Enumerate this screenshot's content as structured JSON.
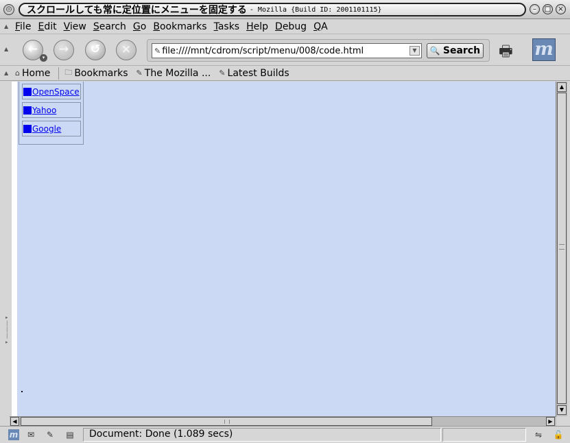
{
  "window": {
    "title": "スクロールしても常に定位置にメニューを固定する",
    "subtitle": "- Mozilla {Build ID: 2001101115}"
  },
  "menubar": {
    "items": [
      {
        "hotkey": "F",
        "rest": "ile"
      },
      {
        "hotkey": "E",
        "rest": "dit"
      },
      {
        "hotkey": "V",
        "rest": "iew"
      },
      {
        "hotkey": "S",
        "rest": "earch"
      },
      {
        "hotkey": "G",
        "rest": "o"
      },
      {
        "hotkey": "B",
        "rest": "ookmarks"
      },
      {
        "hotkey": "T",
        "rest": "asks"
      },
      {
        "hotkey": "H",
        "rest": "elp"
      },
      {
        "hotkey": "D",
        "rest": "ebug"
      },
      {
        "hotkey": "Q",
        "rest": "A"
      }
    ]
  },
  "navbar": {
    "url": "file:////mnt/cdrom/script/menu/008/code.html",
    "search_label": "Search",
    "throbber_letter": "m"
  },
  "personal_toolbar": {
    "home": "Home",
    "bookmarks": "Bookmarks",
    "mozilla": "The Mozilla ...",
    "latest": "Latest Builds"
  },
  "page": {
    "menu_links": [
      "OpenSpace",
      "Yahoo",
      "Google"
    ]
  },
  "statusbar": {
    "text": "Document: Done (1.089 secs)"
  },
  "colors": {
    "page_bg": "#cbd9f4",
    "link": "#0000ee"
  }
}
